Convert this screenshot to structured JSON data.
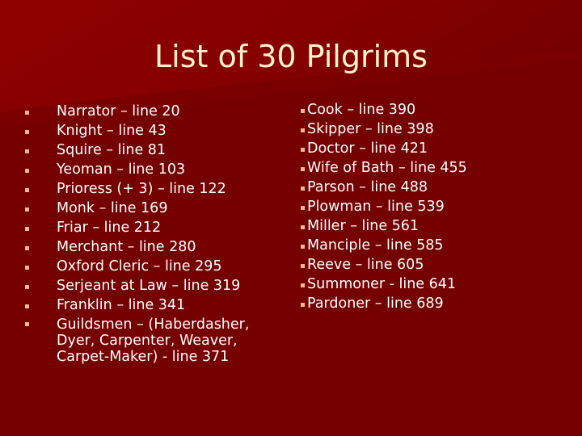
{
  "slide": {
    "title": "List of 30 Pilgrims",
    "colors": {
      "background": "#740000",
      "background_highlight": "#8c0000",
      "title_text": "#fff3cf",
      "body_text": "#ffffff",
      "bullet": "#f7b98c"
    },
    "bullet_icon": "square-bullet-icon",
    "left_column": [
      {
        "text": "Narrator – line 20"
      },
      {
        "text": "Knight – line 43"
      },
      {
        "text": "Squire – line 81"
      },
      {
        "text": "Yeoman – line 103"
      },
      {
        "text": "Prioress (+ 3) – line 122"
      },
      {
        "text": "Monk – line 169"
      },
      {
        "text": "Friar – line 212"
      },
      {
        "text": "Merchant – line 280"
      },
      {
        "text": "Oxford Cleric – line 295"
      },
      {
        "text": "Serjeant at Law – line 319"
      },
      {
        "text": "Franklin – line 341"
      },
      {
        "text": "Guildsmen – (Haberdasher, Dyer, Carpenter, Weaver, Carpet-Maker)  - line 371"
      }
    ],
    "right_column": [
      {
        "text": "Cook – line 390"
      },
      {
        "text": "Skipper – line 398"
      },
      {
        "text": "Doctor – line 421"
      },
      {
        "text": "Wife of Bath – line 455"
      },
      {
        "text": "Parson – line 488"
      },
      {
        "text": "Plowman – line 539"
      },
      {
        "text": "Miller – line 561"
      },
      {
        "text": "Manciple – line 585"
      },
      {
        "text": "Reeve – line 605"
      },
      {
        "text": "Summoner - line 641"
      },
      {
        "text": "Pardoner – line 689"
      }
    ]
  }
}
